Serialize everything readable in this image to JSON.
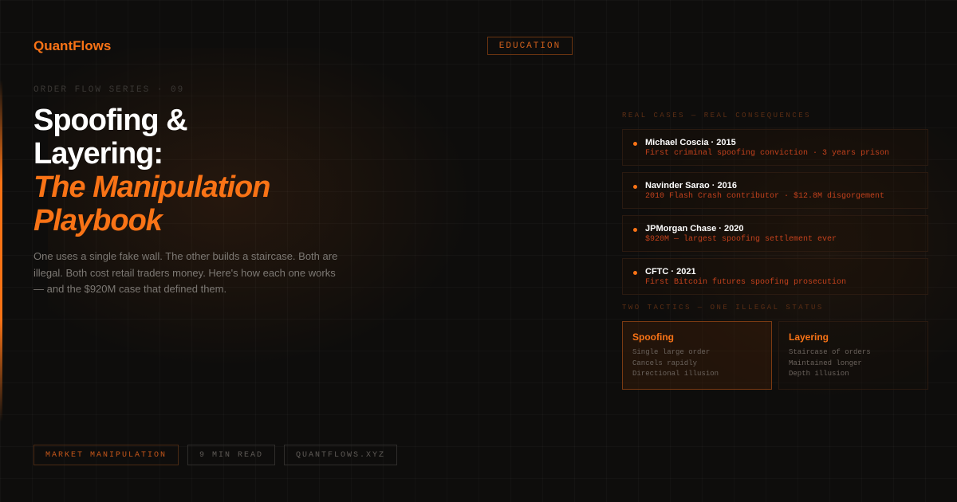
{
  "brand": {
    "name": "QuantFlows",
    "accent": "#f97316"
  },
  "category_badge": "EDUCATION",
  "series_label": "ORDER FLOW SERIES · 09",
  "title": {
    "line1": "Spoofing &",
    "line2": "Layering:",
    "accent_line1": "The Manipulation",
    "accent_line2": "Playbook"
  },
  "description": "One uses a single fake wall. The other builds a staircase. Both are illegal. Both cost retail traders money. Here's how each one works — and the $920M case that defined them.",
  "chips": [
    "MARKET MANIPULATION",
    "9 MIN READ",
    "QUANTFLOWS.XYZ"
  ],
  "cases_label": "REAL CASES — REAL CONSEQUENCES",
  "cases": [
    {
      "name": "Michael Coscia · 2015",
      "detail": "First criminal spoofing conviction · 3 years prison"
    },
    {
      "name": "Navinder Sarao · 2016",
      "detail": "2010 Flash Crash contributor · $12.8M disgorgement"
    },
    {
      "name": "JPMorgan Chase · 2020",
      "detail": "$920M — largest spoofing settlement ever"
    },
    {
      "name": "CFTC · 2021",
      "detail": "First Bitcoin futures spoofing prosecution"
    }
  ],
  "tactics_label": "TWO TACTICS — ONE ILLEGAL STATUS",
  "tactics": [
    {
      "title": "Spoofing",
      "items": [
        "Single large order",
        "Cancels rapidly",
        "Directional illusion"
      ]
    },
    {
      "title": "Layering",
      "items": [
        "Staircase of orders",
        "Maintained longer",
        "Depth illusion"
      ]
    }
  ]
}
